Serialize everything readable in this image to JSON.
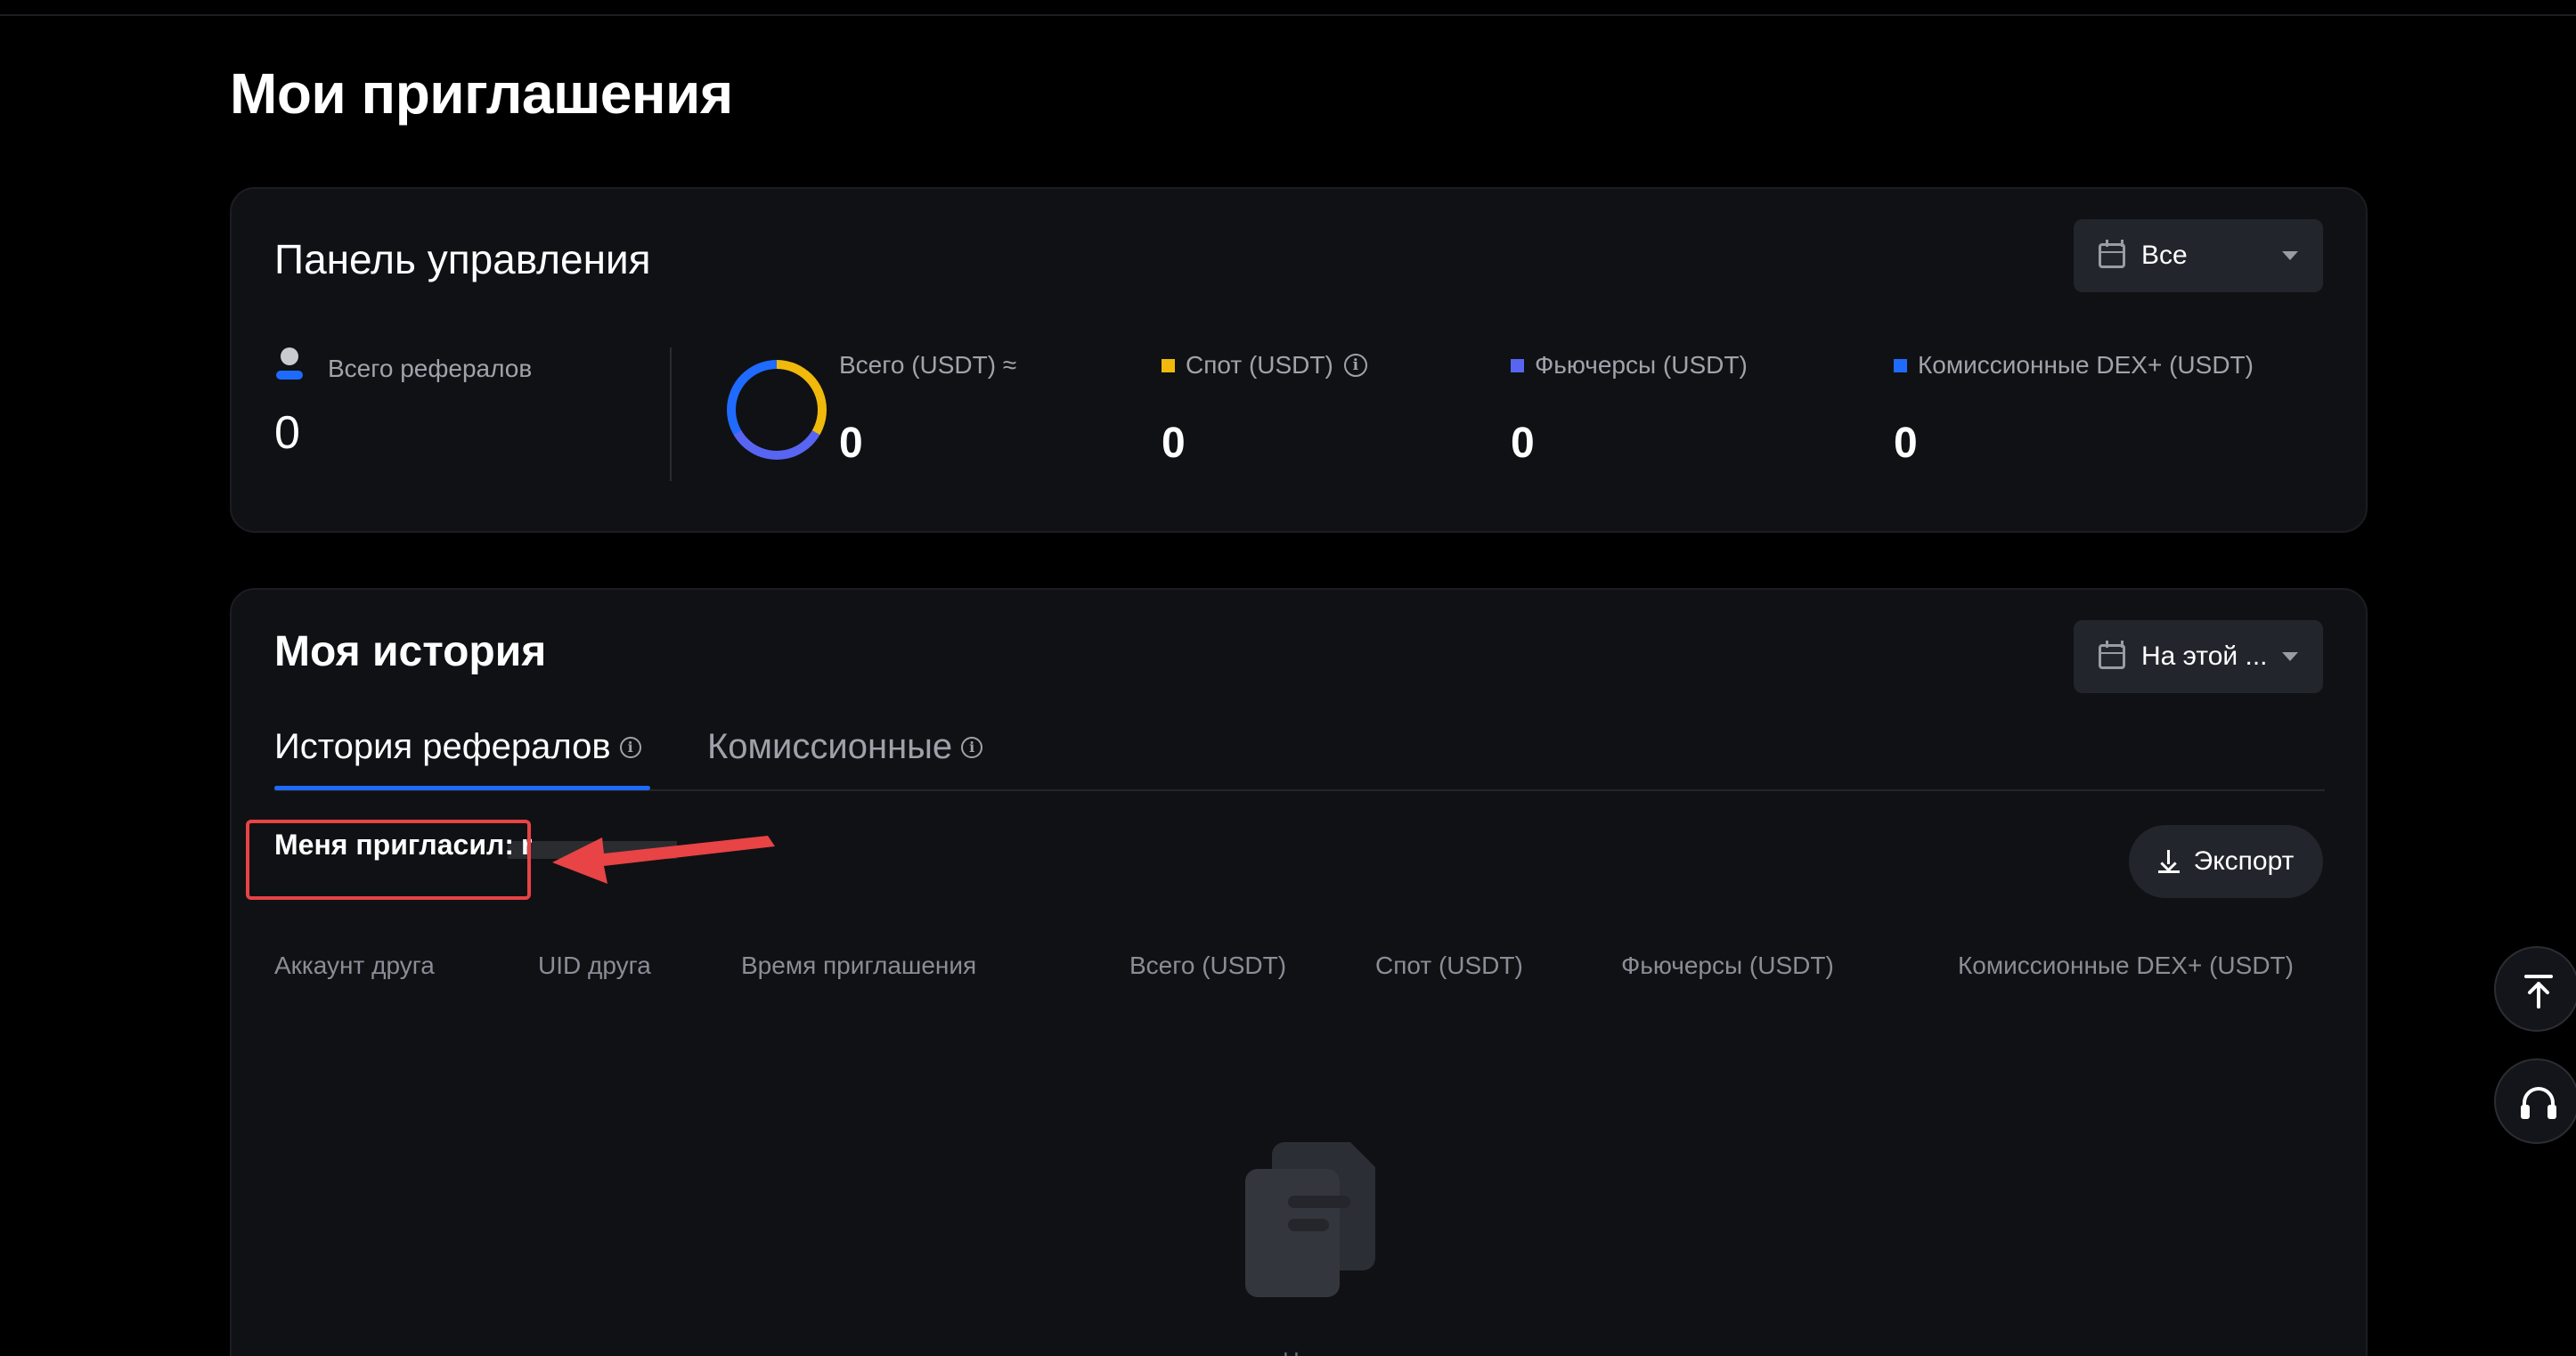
{
  "page": {
    "title": "Мои приглашения"
  },
  "dashboard": {
    "title": "Панель управления",
    "period_filter": "Все",
    "total_referrals": {
      "label": "Всего рефералов",
      "value": "0"
    },
    "stats": [
      {
        "label": "Всего (USDT) ≈",
        "value": "0"
      },
      {
        "label": "Спот (USDT)",
        "value": "0",
        "color": "#f0b90b"
      },
      {
        "label": "Фьючерсы (USDT)",
        "value": "0",
        "color": "#5865f2"
      },
      {
        "label": "Комиссионные DEX+ (USDT)",
        "value": "0",
        "color": "#1f6bff"
      }
    ]
  },
  "history": {
    "title": "Моя история",
    "period_filter": "На этой ...",
    "tabs": [
      {
        "label": "История рефералов",
        "active": true
      },
      {
        "label": "Комиссионные",
        "active": false
      }
    ],
    "invited_by": {
      "label": "Меня пригласил:",
      "value": "r"
    },
    "export_label": "Экспорт",
    "columns": [
      "Аккаунт друга",
      "UID друга",
      "Время приглашения",
      "Всего (USDT)",
      "Спот (USDT)",
      "Фьючерсы (USDT)",
      "Комиссионные DEX+ (USDT)"
    ],
    "empty_text": "Н"
  },
  "icons": {
    "calendar": "calendar-icon",
    "caret": "chevron-down-icon",
    "info": "info-icon",
    "download": "download-icon",
    "scroll_top": "scroll-to-top-icon",
    "support": "headset-icon"
  },
  "colors": {
    "accent": "#1f6bff",
    "annotation": "#e84345"
  }
}
